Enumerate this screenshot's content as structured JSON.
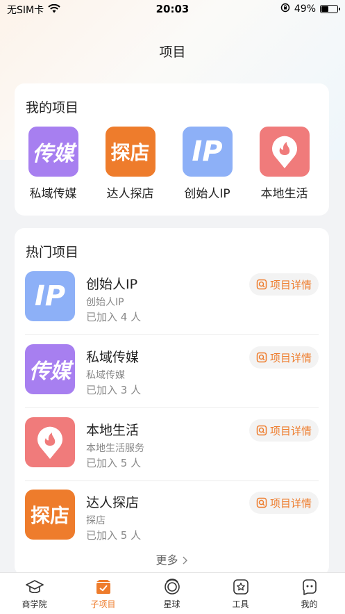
{
  "status_bar": {
    "carrier": "无SIM卡",
    "time": "20:03",
    "battery": "49%",
    "battery_level": 0.49
  },
  "header": {
    "title": "项目"
  },
  "my_projects": {
    "title": "我的项目",
    "items": [
      {
        "label": "私域传媒",
        "icon_text": "传媒",
        "icon": "purple-media-icon",
        "color": "#a77ff0"
      },
      {
        "label": "达人探店",
        "icon_text": "探店",
        "icon": "orange-store-icon",
        "color": "#ee7c2c"
      },
      {
        "label": "创始人IP",
        "icon_text": "IP",
        "icon": "blue-ip-icon",
        "color": "#8db0f7"
      },
      {
        "label": "本地生活",
        "icon_text": "",
        "icon": "location-flame-icon",
        "color": "#f07b7b"
      }
    ]
  },
  "hot_projects": {
    "title": "热门项目",
    "detail_label": "项目详情",
    "more_label": "更多",
    "items": [
      {
        "name": "创始人IP",
        "desc": "创始人IP",
        "count": "已加入 4 人",
        "icon_text": "IP"
      },
      {
        "name": "私域传媒",
        "desc": "私域传媒",
        "count": "已加入 3 人",
        "icon_text": "传媒"
      },
      {
        "name": "本地生活",
        "desc": "本地生活服务",
        "count": "已加入 5 人",
        "icon_text": ""
      },
      {
        "name": "达人探店",
        "desc": "探店",
        "count": "已加入 5 人",
        "icon_text": "探店"
      }
    ]
  },
  "tabbar": {
    "items": [
      {
        "label": "商学院",
        "icon": "graduation-cap-icon"
      },
      {
        "label": "子项目",
        "icon": "project-box-icon"
      },
      {
        "label": "星球",
        "icon": "planet-icon"
      },
      {
        "label": "工具",
        "icon": "star-tool-icon"
      },
      {
        "label": "我的",
        "icon": "profile-face-icon"
      }
    ],
    "active": "子项目",
    "accent": "#ee7c2c"
  }
}
